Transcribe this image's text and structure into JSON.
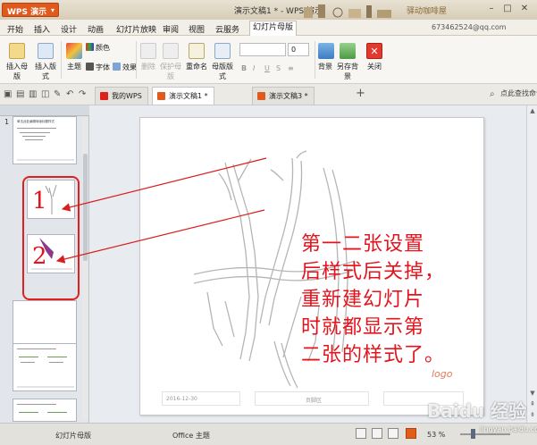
{
  "titlebar": {
    "app_name": "WPS 演示",
    "doc_title": "演示文稿1 * - WPS 演示",
    "banner_text": "驿动咖啡屋"
  },
  "menu": {
    "items": [
      "开始",
      "插入",
      "设计",
      "动画",
      "幻灯片放映",
      "审阅",
      "视图",
      "云服务",
      "幻灯片母版"
    ],
    "active_index": 8,
    "account": "673462524@qq.com"
  },
  "ribbon": {
    "insert_master": "插入母版",
    "insert_layout": "插入版式",
    "theme": "主题",
    "color": "颜色",
    "font": "字体",
    "effect": "效果",
    "delete": "删除",
    "preserve_master": "保护母版",
    "rename": "重命名",
    "master_layout": "母版版式",
    "font_size": "0",
    "background": "背景",
    "save_background": "另存背景",
    "close": "关闭"
  },
  "tabs": [
    {
      "label": "我的WPS",
      "color": "#e0201b"
    },
    {
      "label": "演示文稿1 *",
      "color": "#e05a1e"
    },
    {
      "label": "演示文稿3 *",
      "color": "#e05a1e"
    }
  ],
  "active_tab_index": 1,
  "search_hint": "点此查找命令",
  "slides_pane": {
    "thumb1_number": "1",
    "thumb1_title": "单击此处编辑母版标题样式"
  },
  "slide": {
    "footer_date": "2016-12-30",
    "footer_text": "页脚区",
    "logo_text": "logo"
  },
  "annotation": {
    "num1": "1",
    "num2": "2",
    "text": "第一二张设置\n后样式后关掉，\n重新建幻灯片\n时就都显示第\n二张的样式了。"
  },
  "status": {
    "left": "幻灯片母版",
    "theme": "Office 主题",
    "zoom": "53 %"
  },
  "watermark": {
    "brand": "Baidu 经验",
    "url": "jingyan.baidu.com"
  }
}
